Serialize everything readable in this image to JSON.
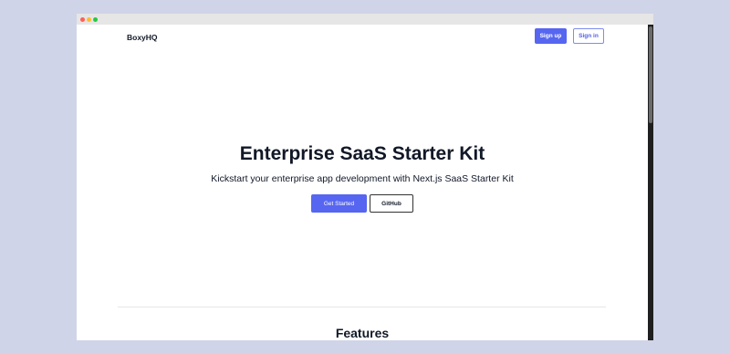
{
  "header": {
    "brand": "BoxyHQ",
    "signup_label": "Sign up",
    "signin_label": "Sign in"
  },
  "hero": {
    "title": "Enterprise SaaS Starter Kit",
    "subtitle": "Kickstart your enterprise app development with Next.js SaaS Starter Kit",
    "get_started_label": "Get Started",
    "github_label": "GitHub"
  },
  "features": {
    "title": "Features"
  },
  "colors": {
    "primary": "#5666f0",
    "page_background": "#cfd4e8",
    "text": "#111827"
  }
}
